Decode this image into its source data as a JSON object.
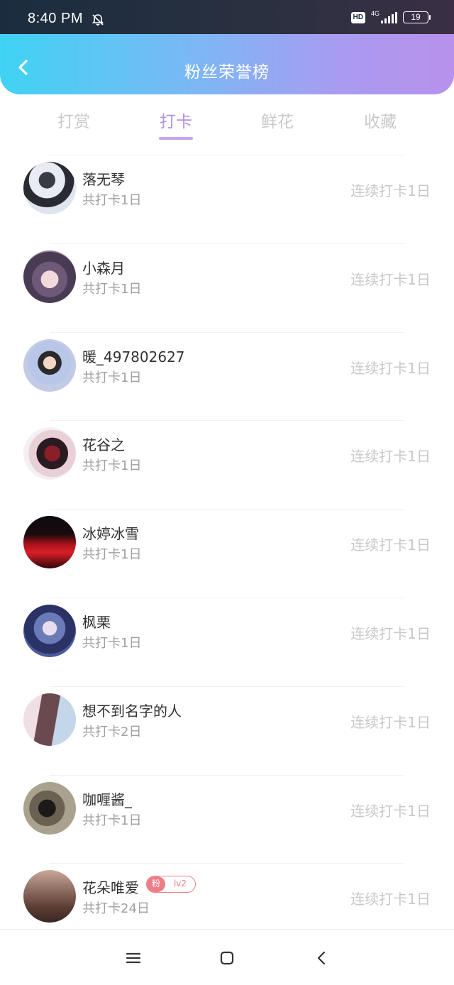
{
  "status_bar": {
    "time": "8:40 PM",
    "hd": "HD",
    "network": "4G",
    "battery": "19",
    "icons": [
      "bell-off-icon",
      "signal-icon",
      "battery-icon"
    ]
  },
  "header": {
    "title": "粉丝荣誉榜",
    "back_icon": "chevron-left-icon",
    "gradient_colors": [
      "#3fd3f4",
      "#b891ec"
    ]
  },
  "tabs": [
    {
      "label": "打赏",
      "active": false
    },
    {
      "label": "打卡",
      "active": true
    },
    {
      "label": "鲜花",
      "active": false
    },
    {
      "label": "收藏",
      "active": false
    }
  ],
  "accent_color": "#b58fe0",
  "rows": [
    {
      "name": "落无琴",
      "total": "共打卡1日",
      "streak": "连续打卡1日"
    },
    {
      "name": "小森月",
      "total": "共打卡1日",
      "streak": "连续打卡1日"
    },
    {
      "name": "暖_497802627",
      "total": "共打卡1日",
      "streak": "连续打卡1日"
    },
    {
      "name": "花谷之",
      "total": "共打卡1日",
      "streak": "连续打卡1日"
    },
    {
      "name": "冰婷冰雪",
      "total": "共打卡1日",
      "streak": "连续打卡1日"
    },
    {
      "name": "枫栗",
      "total": "共打卡1日",
      "streak": "连续打卡1日"
    },
    {
      "name": "想不到名字的人",
      "total": "共打卡2日",
      "streak": "连续打卡1日"
    },
    {
      "name": "咖喱酱_",
      "total": "共打卡1日",
      "streak": "连续打卡1日"
    },
    {
      "name": "花朵唯爱",
      "total": "共打卡24日",
      "streak": "连续打卡1日",
      "badge": {
        "left": "粉",
        "right": "lv2"
      }
    }
  ],
  "nav": {
    "icons": [
      "menu-icon",
      "home-square-icon",
      "back-chevron-icon"
    ]
  }
}
